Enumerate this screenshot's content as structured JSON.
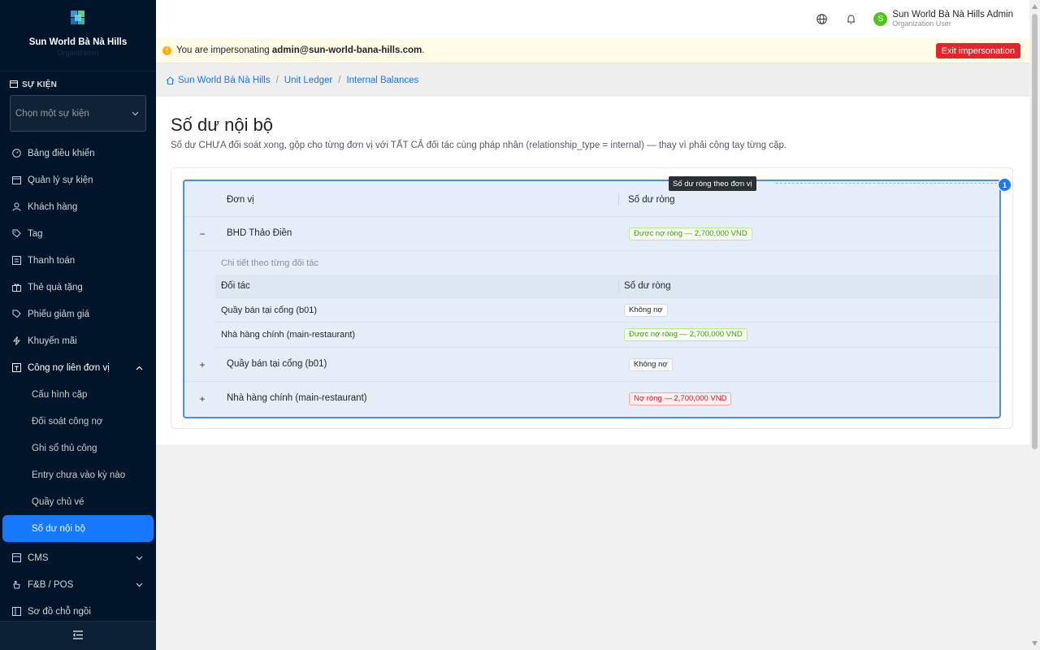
{
  "sidebar": {
    "brand_name": "Sun World Bà Nà Hills",
    "brand_sub": "Organization",
    "event_label": "SỰ KIỆN",
    "event_placeholder": "Chọn một sự kiện",
    "menu": [
      {
        "label": "Bảng điều khiển",
        "icon": "dashboard-icon"
      },
      {
        "label": "Quản lý sự kiện",
        "icon": "calendar-icon"
      },
      {
        "label": "Khách hàng",
        "icon": "user-icon"
      },
      {
        "label": "Tag",
        "icon": "tag-icon"
      },
      {
        "label": "Thanh toán",
        "icon": "payment-icon"
      },
      {
        "label": "Thẻ quà tặng",
        "icon": "gift-icon"
      },
      {
        "label": "Phiếu giảm giá",
        "icon": "coupon-icon"
      },
      {
        "label": "Khuyến mãi",
        "icon": "promo-icon"
      },
      {
        "label": "Công nợ liên đơn vị",
        "icon": "ledger-icon"
      }
    ],
    "submenu": [
      {
        "label": "Cấu hình cặp"
      },
      {
        "label": "Đối soát công nợ"
      },
      {
        "label": "Ghi sổ thủ công"
      },
      {
        "label": "Entry chưa vào kỳ nào"
      },
      {
        "label": "Quầy chủ vé"
      },
      {
        "label": "Số dư nội bộ"
      }
    ],
    "menu_after": [
      {
        "label": "CMS",
        "icon": "cms-icon"
      },
      {
        "label": "F&B / POS",
        "icon": "hand-icon"
      },
      {
        "label": "Sơ đồ chỗ ngồi",
        "icon": "seatmap-icon"
      }
    ]
  },
  "header": {
    "user_initial": "S",
    "user_name": "Sun World Bà Nà Hills Admin",
    "user_role": "Organization User"
  },
  "banner": {
    "prefix": "You are impersonating ",
    "email": "admin@sun-world-bana-hills.com",
    "suffix": ".",
    "exit_label": "Exit impersonation"
  },
  "breadcrumb": [
    "Sun World Bà Nà Hills",
    "Unit Ledger",
    "Internal Balances"
  ],
  "page": {
    "title": "Số dư nội bộ",
    "description": "Số dư CHƯA đối soát xong, gộp cho từng đơn vị với TẤT CẢ đối tác cùng pháp nhân (relationship_type = internal) — thay vì phải cộng tay từng cặp."
  },
  "table": {
    "tooltip": "Số dư ròng theo đơn vị",
    "badge": "1",
    "col_unit": "Đơn vị",
    "col_balance": "Số dư ròng",
    "rows": [
      {
        "unit": "BHD Thảo Điền",
        "balance": "Được nợ ròng — 2,700,000 VND",
        "status": "green",
        "expander": "−"
      },
      {
        "unit": "Quầy bán tại cổng (b01)",
        "balance": "Không nợ",
        "status": "gray",
        "expander": "+"
      },
      {
        "unit": "Nhà hàng chính (main-restaurant)",
        "balance": "Nợ ròng — 2,700,000 VND",
        "status": "red",
        "expander": "+"
      }
    ],
    "detail": {
      "caption": "Chi tiết theo từng đối tác",
      "col_partner": "Đối tác",
      "col_balance": "Số dư ròng",
      "rows": [
        {
          "partner": "Quầy bán tại cổng (b01)",
          "balance": "Không nợ",
          "status": "gray"
        },
        {
          "partner": "Nhà hàng chính (main-restaurant)",
          "balance": "Được nợ ròng — 2,700,000 VND",
          "status": "green"
        }
      ]
    }
  }
}
